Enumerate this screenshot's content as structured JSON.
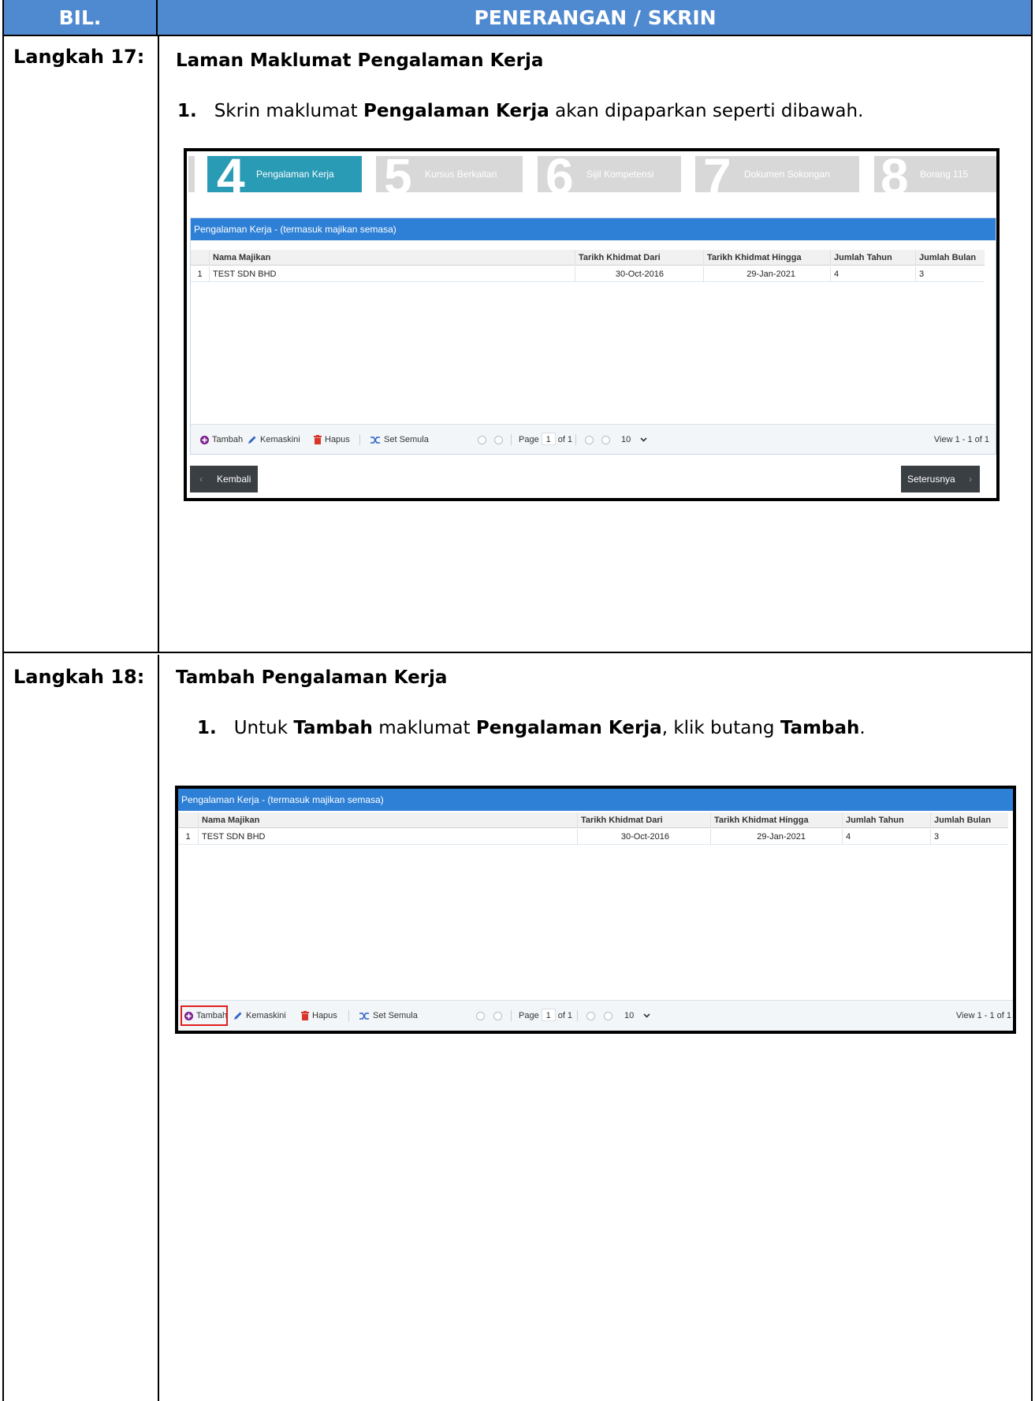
{
  "header": {
    "bil": "BIL.",
    "penerangan": "PENERANGAN / SKRIN"
  },
  "step17": {
    "label": "Langkah 17:",
    "title": "Laman Maklumat Pengalaman Kerja",
    "num": "1.",
    "text_a": "Skrin maklumat ",
    "text_b": "Pengalaman Kerja",
    "text_c": " akan dipaparkan seperti dibawah."
  },
  "step18": {
    "label": "Langkah 18:",
    "title": "Tambah Pengalaman Kerja",
    "num": "1.",
    "text_a": "Untuk ",
    "text_b": "Tambah",
    "text_c": " maklumat ",
    "text_d": "Pengalaman Kerja",
    "text_e": ", klik butang ",
    "text_f": "Tambah",
    "text_g": "."
  },
  "wizard": {
    "steps": [
      {
        "num": "4",
        "label": "Pengalaman Kerja",
        "active": true
      },
      {
        "num": "5",
        "label": "Kursus Berkaitan",
        "active": false
      },
      {
        "num": "6",
        "label": "Sijil Kompetensi",
        "active": false
      },
      {
        "num": "7",
        "label": "Dokumen Sokongan",
        "active": false
      },
      {
        "num": "8",
        "label": "Borang 115",
        "active": false
      }
    ]
  },
  "grid": {
    "caption": "Pengalaman Kerja - (termasuk majikan semasa)",
    "columns": [
      "Nama Majikan",
      "Tarikh Khidmat Dari",
      "Tarikh Khidmat Hingga",
      "Jumlah Tahun",
      "Jumlah Bulan"
    ],
    "rows": [
      {
        "no": "1",
        "nama": "TEST SDN BHD",
        "dari": "30-Oct-2016",
        "hingga": "29-Jan-2021",
        "tahun": "4",
        "bulan": "3"
      }
    ]
  },
  "pager": {
    "tambah": "Tambah",
    "kemaskini": "Kemaskini",
    "hapus": "Hapus",
    "set_semula": "Set Semula",
    "page_label": "Page",
    "page_value": "1",
    "of_label": "of 1",
    "rows_per_page": "10",
    "view": "View 1 - 1 of 1"
  },
  "nav": {
    "back": "Kembali",
    "next": "Seterusnya"
  },
  "colors": {
    "header_blue": "#4f89cf",
    "grid_caption": "#2e80d6",
    "active_step": "#2a9bb5",
    "highlight": "#e0201e"
  }
}
